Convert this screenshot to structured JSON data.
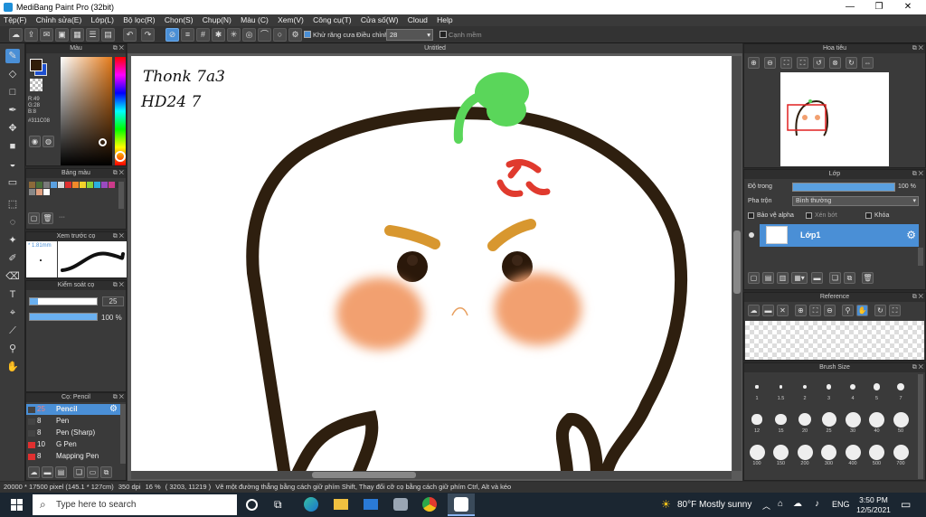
{
  "window": {
    "title": "MediBang Paint Pro (32bit)",
    "minimize": "—",
    "maximize": "❐",
    "close": "✕"
  },
  "menu": [
    "Tệp(F)",
    "Chỉnh sửa(E)",
    "Lớp(L)",
    "Bộ lọc(R)",
    "Chọn(S)",
    "Chụp(N)",
    "Màu (C)",
    "Xem(V)",
    "Công cụ(T)",
    "Cửa số(W)",
    "Cloud",
    "Help"
  ],
  "toolbar": {
    "antialias_label": "Khử răng cưa",
    "adjust_label": "Điều chỉnh",
    "adjust_value": "28",
    "soft_edge_label": "Cạnh mềm"
  },
  "color_panel": {
    "title": "Màu",
    "rgb": [
      "R:49",
      "G:28",
      "B:8"
    ],
    "hex": "#311C08",
    "fg_color": "#311c08",
    "bg_color": "#ffffff"
  },
  "swatch_panel": {
    "title": "Bảng màu",
    "more": "···"
  },
  "brush_preview": {
    "title": "Xem trước cọ",
    "size": "* 1.81mm"
  },
  "brush_control": {
    "title": "Kiểm soát cọ",
    "size": "25",
    "opacity": "100 %",
    "size_fraction": 0.25,
    "opacity_fraction": 1.0
  },
  "brush_list": {
    "title": "Cọ: Pencil",
    "items": [
      {
        "size": "25",
        "name": "Pencil",
        "color": "#444444"
      },
      {
        "size": "8",
        "name": "Pen",
        "color": "#444444"
      },
      {
        "size": "8",
        "name": "Pen (Sharp)",
        "color": "#444444"
      },
      {
        "size": "10",
        "name": "G Pen",
        "color": "#e03030"
      },
      {
        "size": "8",
        "name": "Mapping Pen",
        "color": "#e03030"
      }
    ]
  },
  "canvas": {
    "tab_title": "Untitled",
    "handwriting_line1": "Thonk 7a3",
    "handwriting_line2": "HD24 7"
  },
  "navigator": {
    "title": "Hoa tiêu"
  },
  "layer_panel": {
    "title": "Lớp",
    "opacity_label": "Độ trong",
    "opacity_value": "100 %",
    "opacity_fraction": 1.0,
    "blend_label": "Pha trộn",
    "blend_value": "Bình thường",
    "protect_alpha": "Bảo vệ alpha",
    "clipping": "Xén bớt",
    "lock": "Khóa",
    "layer_name": "Lớp1"
  },
  "reference": {
    "title": "Reference"
  },
  "brush_size_panel": {
    "title": "Brush Size",
    "sizes": [
      "1",
      "1.5",
      "2",
      "3",
      "4",
      "5",
      "7",
      "12",
      "15",
      "20",
      "25",
      "30",
      "40",
      "50",
      "100",
      "150",
      "200",
      "300",
      "400",
      "500",
      "700"
    ]
  },
  "status": {
    "dimensions": "20000 * 17500 pixel",
    "physical": "(145.1 * 127cm)",
    "dpi": "350 dpi",
    "zoom": "16 %",
    "coords": "( 3203, 11219 )",
    "hint": "Vẽ một đường thẳng bằng cách giữ phím Shift, Thay đổi cỡ cọ bằng cách giữ phím Ctrl, Alt và kéo"
  },
  "taskbar": {
    "search_placeholder": "Type here to search",
    "weather": "80°F  Mostly sunny",
    "lang": "ENG",
    "time": "3:50 PM",
    "date": "12/5/2021"
  }
}
